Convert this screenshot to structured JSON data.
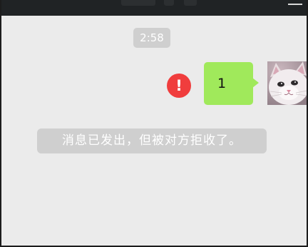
{
  "chat": {
    "timestamp": "2:58",
    "messages": [
      {
        "sender": "self",
        "text": "1",
        "status": "failed",
        "status_icon": "!"
      }
    ],
    "system_notice": "消息已发出，但被对方拒收了。"
  },
  "colors": {
    "background": "#ebebeb",
    "bubble_self": "#a0e95b",
    "error": "#f03d3d",
    "system_pill": "#cfcfcf"
  },
  "icons": {
    "status": "exclamation-error-icon",
    "avatar": "cat-avatar"
  }
}
